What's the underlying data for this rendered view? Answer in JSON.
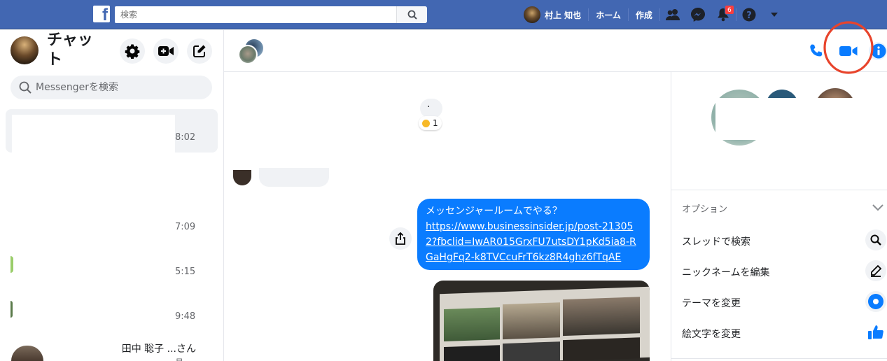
{
  "fb_header": {
    "logo": "f",
    "search_placeholder": "検索",
    "user_name": "村上 知也",
    "home_label": "ホーム",
    "create_label": "作成",
    "notification_count": "6"
  },
  "sidebar": {
    "title": "チャット",
    "search_placeholder": "Messengerを検索",
    "conversations": [
      {
        "time": "8:02",
        "name": ""
      },
      {
        "time": "7:09",
        "name": ""
      },
      {
        "time": "5:15",
        "name": ""
      },
      {
        "time": "9:48",
        "name": ""
      },
      {
        "time": "月",
        "name": "田中 聡子 ...さん"
      }
    ]
  },
  "thread": {
    "reaction_count": "1",
    "outgoing_message": {
      "text": "メッセンジャールームでやる？",
      "link": "https://www.businessinsider.jp/post-213052?fbclid=IwAR015GrxFU7utsDY1pKd5ia8-RGaHgFq2-k8TVCcuFrT6kz8R4ghz6fTqAE"
    }
  },
  "info_panel": {
    "options_label": "オプション",
    "options": [
      {
        "label": "スレッドで検索",
        "icon": "search-icon"
      },
      {
        "label": "ニックネームを編集",
        "icon": "pencil-icon"
      },
      {
        "label": "テーマを変更",
        "icon": "theme-icon"
      },
      {
        "label": "絵文字を変更",
        "icon": "thumbs-up-icon"
      }
    ]
  },
  "colors": {
    "fb_blue": "#4267b2",
    "messenger_blue": "#0a7cff",
    "annotation_red": "#e8442c"
  }
}
